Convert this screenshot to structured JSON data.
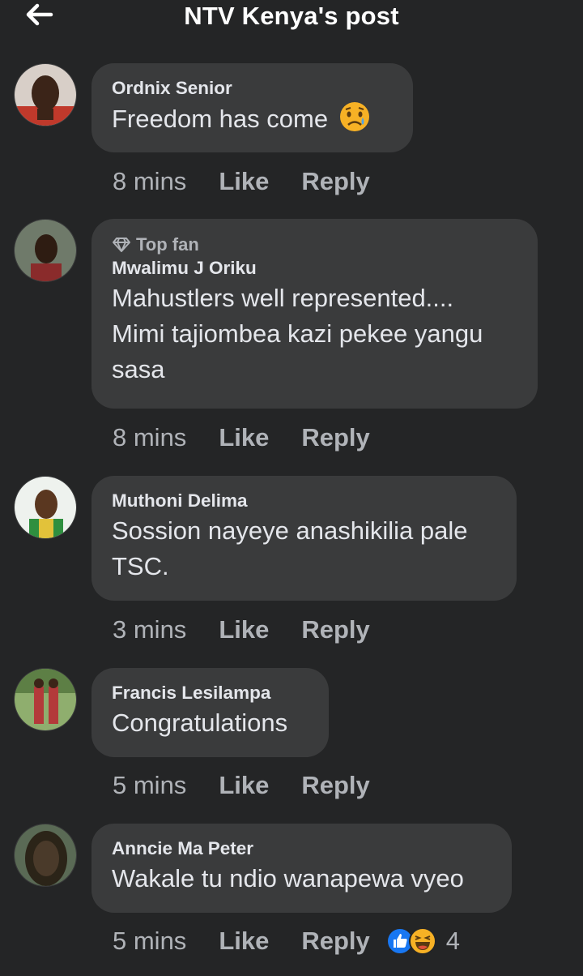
{
  "header": {
    "title": "NTV Kenya's post",
    "back_icon": "back-arrow-icon"
  },
  "comments": [
    {
      "name": "Ordnix Senior",
      "badge": "",
      "lines": [
        "Freedom has come"
      ],
      "emoji": "sad-tear-emoji",
      "time": "8 mins",
      "like": "Like",
      "reply": "Reply"
    },
    {
      "name": "Mwalimu J Oriku",
      "badge": "Top fan",
      "lines": [
        "Mahustlers well represented....",
        "Mimi tajiombea kazi pekee yangu",
        "sasa"
      ],
      "time": "8 mins",
      "like": "Like",
      "reply": "Reply"
    },
    {
      "name": "Muthoni Delima",
      "badge": "",
      "lines": [
        "Sossion nayeye anashikilia pale",
        "TSC."
      ],
      "time": "3 mins",
      "like": "Like",
      "reply": "Reply"
    },
    {
      "name": "Francis Lesilampa",
      "badge": "",
      "lines": [
        "Congratulations"
      ],
      "time": "5 mins",
      "like": "Like",
      "reply": "Reply"
    },
    {
      "name": "Anncie Ma Peter",
      "badge": "",
      "lines": [
        "Wakale tu ndio wanapewa vyeo"
      ],
      "time": "5 mins",
      "like": "Like",
      "reply": "Reply",
      "reactions": [
        "like-reaction-icon",
        "haha-reaction-icon"
      ],
      "reaction_count": "4"
    }
  ],
  "colors": {
    "background": "#242526",
    "bubble": "#3a3b3c",
    "secondary_text": "#b0b3b8",
    "like_blue": "#1877f2",
    "haha_yellow": "#f7b125"
  }
}
